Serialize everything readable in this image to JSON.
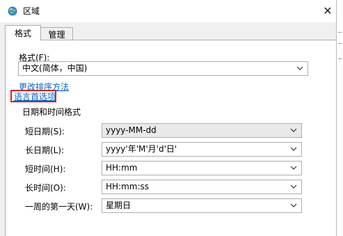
{
  "window": {
    "title": "区域",
    "close_glyph": "✕"
  },
  "tabs": [
    {
      "label": "格式",
      "active": true
    },
    {
      "label": "管理",
      "active": false
    }
  ],
  "format_section": {
    "label": "格式(F):",
    "value": "中文(简体，中国)"
  },
  "links": {
    "change_sort": "更改排序方法",
    "language_prefs": "语言首选项"
  },
  "datetime_group": {
    "title": "日期和时间格式",
    "rows": [
      {
        "label": "短日期(S):",
        "value": "yyyy-MM-dd"
      },
      {
        "label": "长日期(L):",
        "value": "yyyy'年'M'月'd'日'"
      },
      {
        "label": "短时间(H):",
        "value": "HH:mm"
      },
      {
        "label": "长时间(O):",
        "value": "HH:mm:ss"
      },
      {
        "label": "一周的第一天(W):",
        "value": "星期日"
      }
    ]
  },
  "colors": {
    "link": "#0066cc",
    "highlight_box": "#e02020",
    "dialog_bg": "#f0f0f0"
  },
  "icons": {
    "title_icon": "globe-icon",
    "dropdown": "chevron-down-icon",
    "close": "close-icon"
  }
}
